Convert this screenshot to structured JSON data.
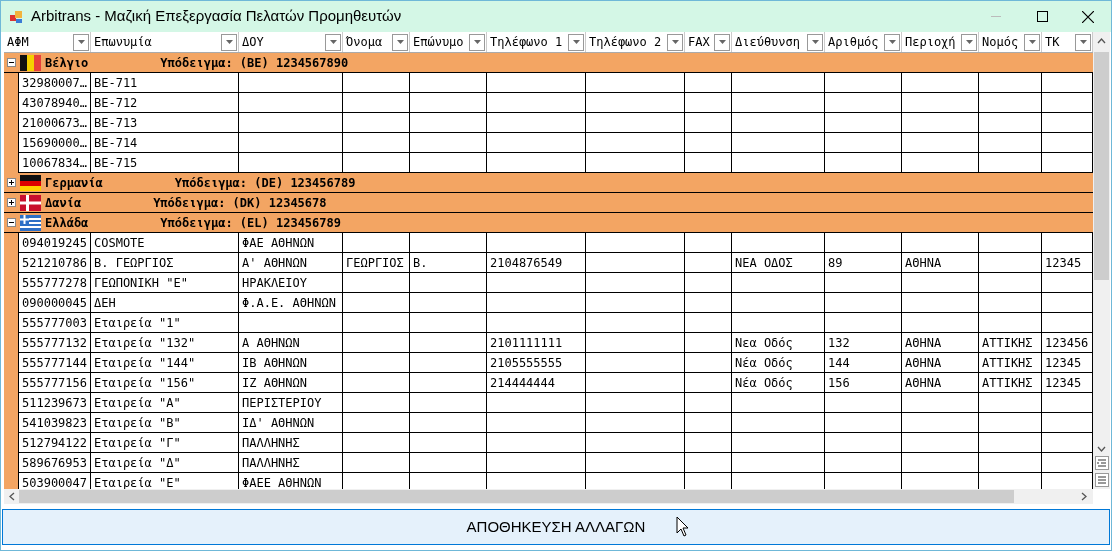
{
  "window": {
    "title": "Arbitrans - Μαζική Επεξεργασία Πελατών Προμηθευτών"
  },
  "columns": [
    "ΑΦΜ",
    "Επωνυμία",
    "ΔΟΥ",
    "Όνομα",
    "Επώνυμο",
    "Τηλέφωνο 1",
    "Τηλέφωνο 2",
    "FAX",
    "Διεύθυνση",
    "Αριθμός",
    "Περιοχή",
    "Νομός",
    "ΤΚ"
  ],
  "groups": [
    {
      "kind": "belgium",
      "name": "Βέλγιο",
      "sample": "Υπόδειγμα: (BE) 1234567890",
      "expanded": true,
      "rows": [
        {
          "cells": [
            "32980007…",
            "BE-711",
            null,
            null,
            null,
            null,
            null,
            null,
            null,
            null,
            null,
            null,
            null
          ]
        },
        {
          "cells": [
            "43078940…",
            "BE-712",
            null,
            null,
            null,
            null,
            null,
            null,
            null,
            null,
            null,
            null,
            null
          ]
        },
        {
          "cells": [
            "21000673…",
            "BE-713",
            null,
            null,
            null,
            null,
            null,
            null,
            null,
            null,
            null,
            null,
            null
          ]
        },
        {
          "cells": [
            "15690000…",
            "BE-714",
            null,
            null,
            null,
            null,
            null,
            null,
            null,
            null,
            null,
            null,
            null
          ]
        },
        {
          "cells": [
            "10067834…",
            "BE-715",
            null,
            null,
            null,
            null,
            null,
            null,
            null,
            null,
            null,
            null,
            null
          ]
        }
      ]
    },
    {
      "kind": "germany",
      "name": "Γερμανία",
      "sample": "Υπόδειγμα: (DE) 123456789",
      "expanded": false
    },
    {
      "kind": "denmark",
      "name": "Δανία",
      "sample": "Υπόδειγμα: (DK) 12345678",
      "expanded": false
    },
    {
      "kind": "greece",
      "name": "Ελλάδα",
      "sample": "Υπόδειγμα: (EL) 123456789",
      "expanded": true,
      "rows": [
        {
          "cells": [
            "094019245",
            "COSMOTE",
            "ΦΑΕ ΑΘΗΝΩΝ",
            null,
            null,
            null,
            null,
            null,
            null,
            null,
            null,
            null,
            null
          ]
        },
        {
          "cells": [
            "521210786",
            "Β. ΓΕΩΡΓΙΟΣ",
            "Α' ΑΘΗΝΩΝ",
            "ΓΕΩΡΓΙΟΣ",
            "Β.",
            "2104876549",
            null,
            null,
            "ΝΕΑ ΟΔΟΣ",
            "89",
            "ΑΘΗΝΑ",
            null,
            "12345"
          ]
        },
        {
          "cells": [
            "555777278",
            "ΓΕΩΠΟΝΙΚΗ \"Ε\"",
            "ΗΡΑΚΛΕΙΟΥ",
            null,
            null,
            null,
            null,
            null,
            null,
            null,
            null,
            null,
            null
          ]
        },
        {
          "cells": [
            "090000045",
            "ΔΕΗ",
            "Φ.Α.Ε. ΑΘΗΝΩΝ",
            null,
            null,
            null,
            null,
            null,
            null,
            null,
            null,
            null,
            null
          ]
        },
        {
          "cells": [
            "555777003",
            "Εταιρεία \"1\"",
            null,
            null,
            null,
            null,
            null,
            null,
            null,
            null,
            null,
            null,
            null
          ]
        },
        {
          "cells": [
            "555777132",
            "Εταιρεία \"132\"",
            "Α ΑΘΗΝΩΝ",
            null,
            null,
            "2101111111",
            null,
            null,
            "Νεα Οδός",
            "132",
            "ΑΘΗΝΑ",
            "ΑΤΤΙΚΗΣ",
            "123456"
          ]
        },
        {
          "cells": [
            "555777144",
            "Εταιρεία \"144\"",
            "ΙΒ ΑΘΗΝΩΝ",
            null,
            null,
            "2105555555",
            null,
            null,
            "Νέα Οδός",
            "144",
            "ΑΘΗΝΑ",
            "ΑΤΤΙΚΗΣ",
            "12345"
          ]
        },
        {
          "cells": [
            "555777156",
            "Εταιρεία \"156\"",
            "ΙΖ ΑΘΗΝΩΝ",
            null,
            null,
            "214444444",
            null,
            null,
            "Νέα Οδός",
            "156",
            "ΑΘΗΝΑ",
            "ΑΤΤΙΚΗΣ",
            "12345"
          ]
        },
        {
          "cells": [
            "511239673",
            "Εταιρεία \"Α\"",
            "ΠΕΡΙΣΤΕΡΙΟΥ",
            null,
            null,
            null,
            null,
            null,
            null,
            null,
            null,
            null,
            null
          ]
        },
        {
          "cells": [
            "541039823",
            "Εταιρεία \"Β\"",
            "ΙΔ' ΑΘΗΝΩΝ",
            null,
            null,
            null,
            null,
            null,
            null,
            null,
            null,
            null,
            null
          ]
        },
        {
          "cells": [
            "512794122",
            "Εταιρεία \"Γ\"",
            "ΠΑΛΛΗΝΗΣ",
            null,
            null,
            null,
            null,
            null,
            null,
            null,
            null,
            null,
            null
          ]
        },
        {
          "cells": [
            "589676953",
            "Εταιρεία \"Δ\"",
            "ΠΑΛΛΗΝΗΣ",
            null,
            null,
            null,
            null,
            null,
            null,
            null,
            null,
            null,
            null
          ]
        },
        {
          "cells": [
            "503900047",
            "Εταιρεία \"Ε\"",
            "ΦΑΕΕ ΑΘΗΝΩΝ",
            null,
            null,
            null,
            null,
            null,
            null,
            null,
            null,
            null,
            null
          ]
        }
      ]
    }
  ],
  "save_button": "ΑΠΟΘΗΚΕΥΣΗ ΑΛΛΑΓΩΝ"
}
